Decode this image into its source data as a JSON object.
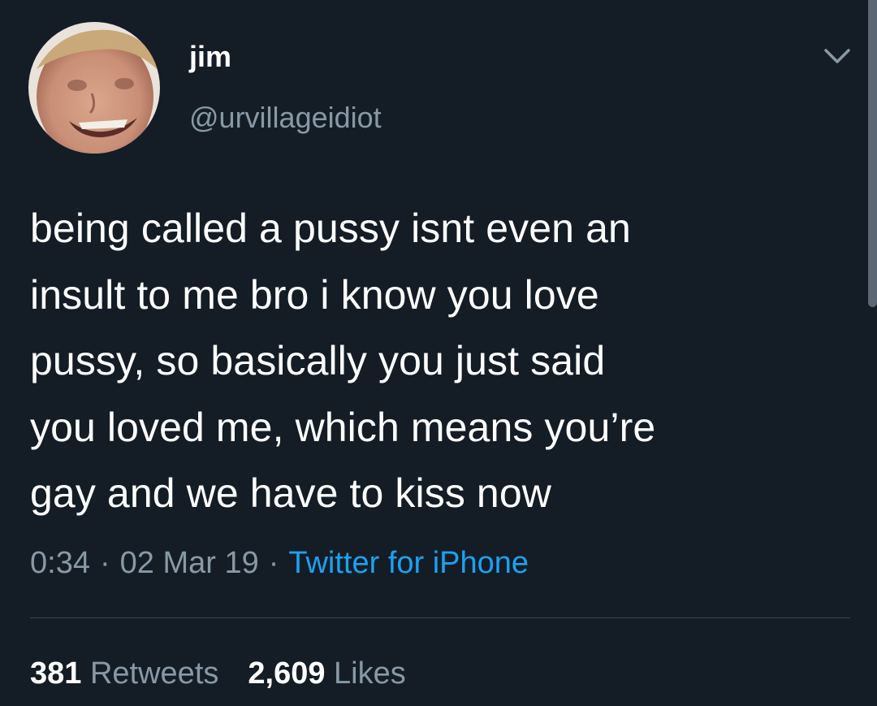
{
  "user": {
    "display_name": "jim",
    "handle": "@urvillageidiot",
    "avatar_icon": "avatar-photo"
  },
  "tweet": {
    "lines": [
      "being called a pussy isnt even an",
      "insult to me bro i know you love",
      "pussy, so basically you just said",
      "you loved me, which means you’re",
      "gay and we have to kiss now"
    ],
    "time": "0:34",
    "date": "02 Mar 19",
    "separator": "·",
    "source": "Twitter for iPhone"
  },
  "stats": {
    "retweets_count": "381",
    "retweets_label": "Retweets",
    "likes_count": "2,609",
    "likes_label": "Likes"
  },
  "menu": {
    "icon": "chevron-down-icon"
  },
  "colors": {
    "background": "#141d26",
    "text_primary": "#ffffff",
    "text_secondary": "#8899a6",
    "accent": "#1da1f2",
    "divider": "#38444d"
  }
}
